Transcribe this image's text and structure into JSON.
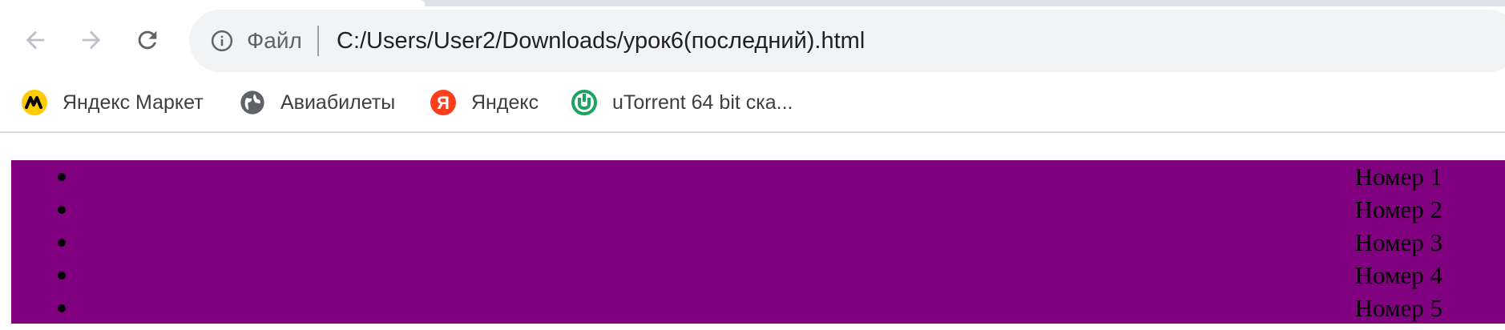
{
  "browser": {
    "scheme_label": "Файл",
    "url": "C:/Users/User2/Downloads/урок6(последний).html",
    "icons": {
      "back": "arrow-left-icon",
      "forward": "arrow-right-icon",
      "reload": "reload-icon",
      "site_info": "info-icon"
    }
  },
  "bookmarks": [
    {
      "label": "Яндекс Маркет",
      "icon": "yandex-market-icon",
      "color": "#fc3f1d"
    },
    {
      "label": "Авиабилеты",
      "icon": "globe-icon",
      "color": "#5f6368"
    },
    {
      "label": "Яндекс",
      "icon": "yandex-icon",
      "color": "#fc3f1d"
    },
    {
      "label": "uTorrent 64 bit ска...",
      "icon": "utorrent-icon",
      "color": "#1da25f"
    }
  ],
  "page": {
    "background_color": "#800080",
    "items": [
      "Номер 1",
      "Номер 2",
      "Номер 3",
      "Номер 4",
      "Номер 5"
    ]
  }
}
